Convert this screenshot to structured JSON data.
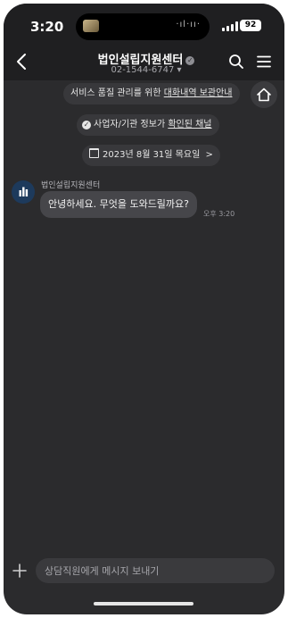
{
  "status_bar": {
    "time": "3:20",
    "battery": "92",
    "island_dots": "·ıl·ıı·"
  },
  "header": {
    "title": "법인설립지원센터",
    "phone": "02-1544-6747",
    "phone_caret": "▾",
    "icons": [
      "back-icon",
      "verified-icon",
      "search-icon",
      "menu-icon"
    ]
  },
  "notices": {
    "archive_prefix": "서비스 품질 관리를 위한 ",
    "archive_link": "대화내역 보관안내",
    "business_prefix": "사업자/기관 정보가 ",
    "business_link": "확인된 채널",
    "date": "2023년 8월 31일 목요일",
    "date_chevron": ">"
  },
  "messages": [
    {
      "sender": "법인설립지원센터",
      "text": "안녕하세요. 무엇을 도와드릴까요?",
      "time": "오후 3:20"
    }
  ],
  "composer": {
    "placeholder": "상담직원에게 메시지 보내기",
    "value": ""
  },
  "colors": {
    "background": "#2b2b2d",
    "header": "#1f1f21",
    "bubble": "#46464a",
    "pill": "#38383b",
    "avatar": "#1d3a5c"
  }
}
